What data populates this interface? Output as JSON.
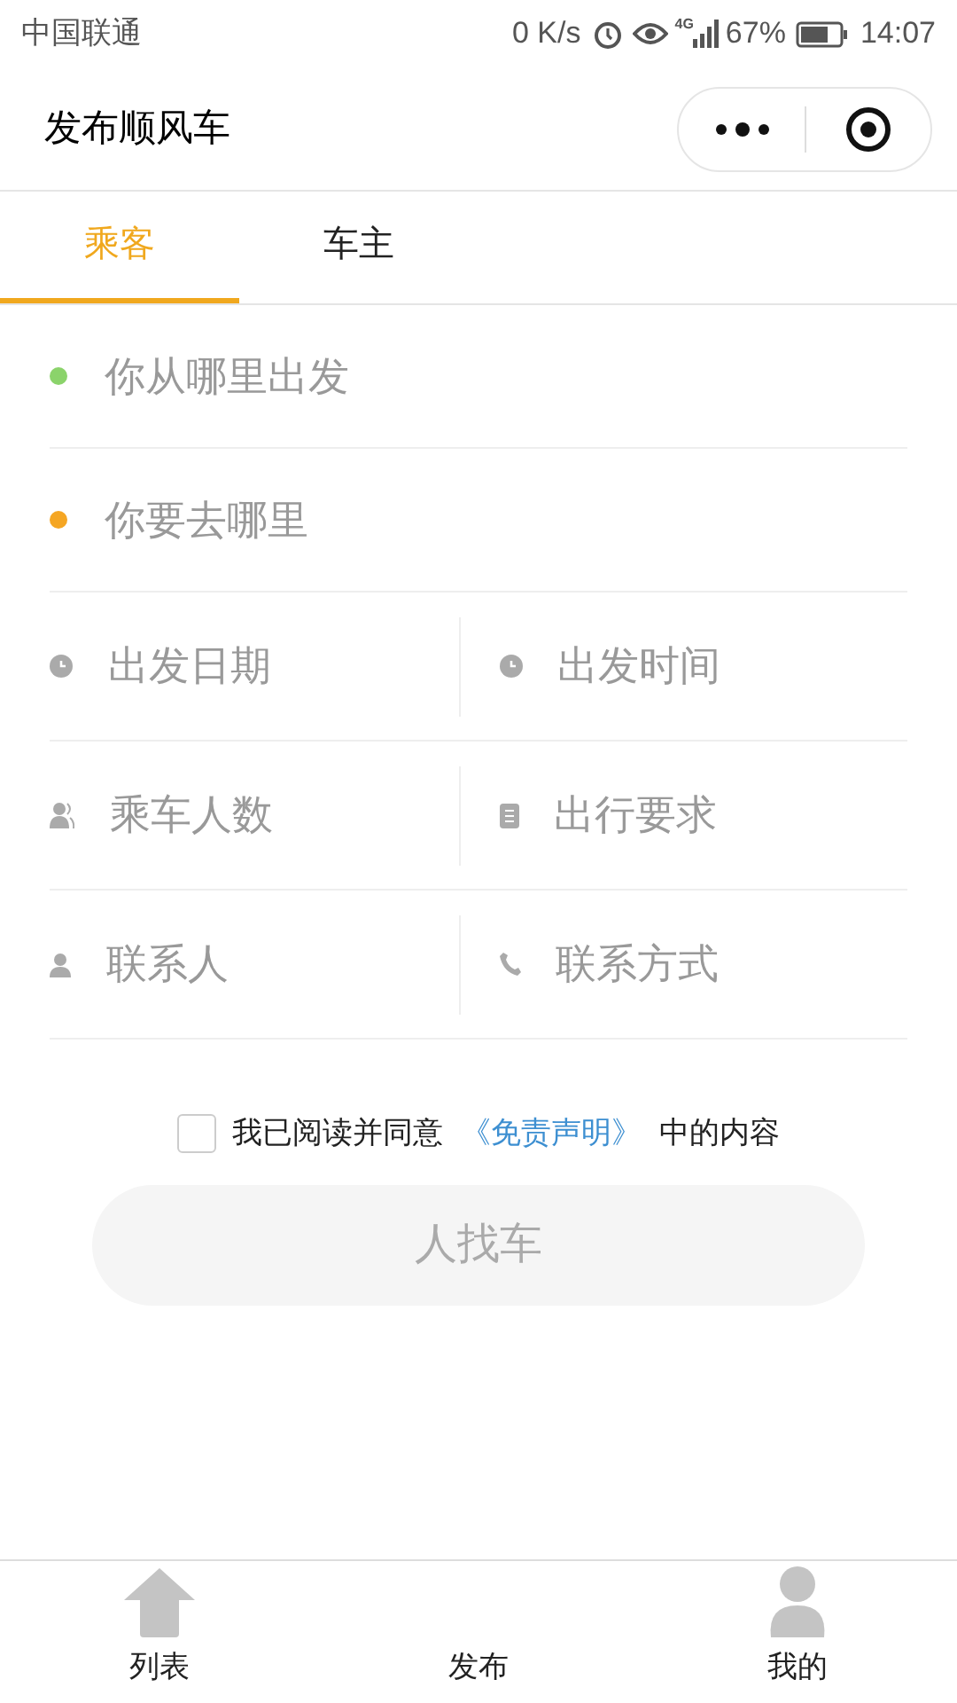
{
  "status_bar": {
    "carrier": "中国联通",
    "speed": "0 K/s",
    "network": "4G",
    "battery": "67%",
    "time": "14:07"
  },
  "header": {
    "title": "发布顺风车"
  },
  "tabs": [
    {
      "label": "乘客",
      "selected": true
    },
    {
      "label": "车主",
      "selected": false
    }
  ],
  "locations": [
    {
      "placeholder": "你从哪里出发",
      "color": "#8bd36b"
    },
    {
      "placeholder": "你要去哪里",
      "color": "#f5a623"
    }
  ],
  "fields": [
    [
      {
        "kind": "clock",
        "placeholder": "出发日期"
      },
      {
        "kind": "clock",
        "placeholder": "出发时间"
      }
    ],
    [
      {
        "kind": "people",
        "placeholder": "乘车人数"
      },
      {
        "kind": "note",
        "placeholder": "出行要求"
      }
    ],
    [
      {
        "kind": "person",
        "placeholder": "联系人"
      },
      {
        "kind": "phone",
        "placeholder": "联系方式"
      }
    ]
  ],
  "agreement": {
    "checked": false,
    "before": "我已阅读并同意",
    "link": "《免责声明》",
    "after": "中的内容"
  },
  "submit_button": "人找车",
  "tab_bar": [
    {
      "label": "列表",
      "kind": "house"
    },
    {
      "label": "发布",
      "kind": "plain"
    },
    {
      "label": "我的",
      "kind": "person"
    }
  ]
}
